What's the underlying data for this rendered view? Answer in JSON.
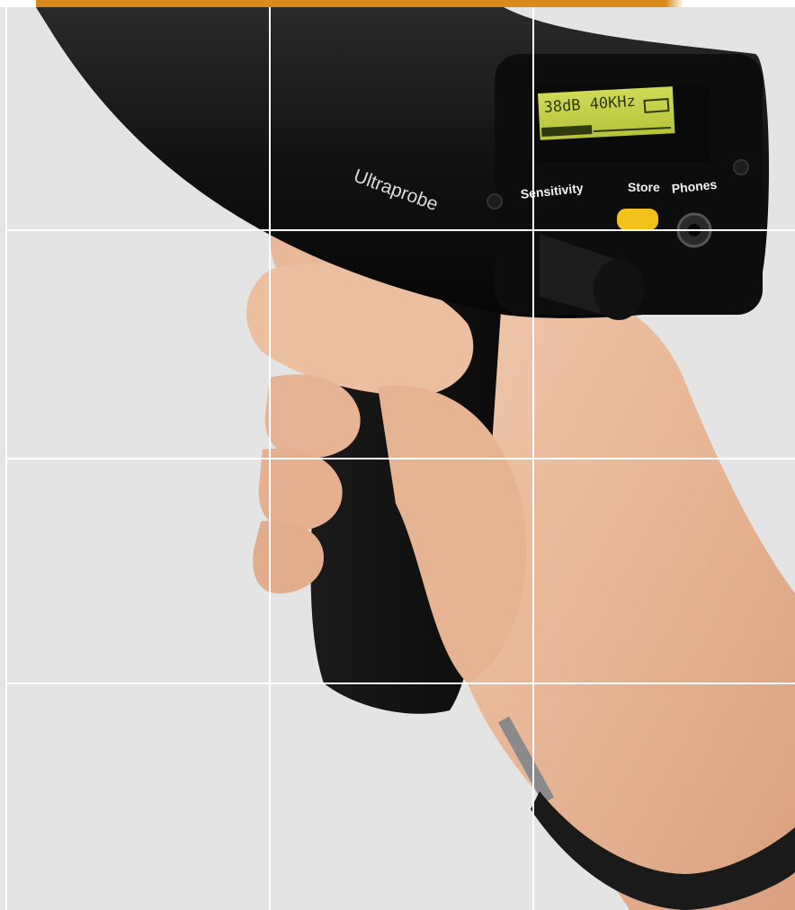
{
  "device": {
    "brand_label": "Ultraprobe",
    "sensitivity_label": "Sensitivity",
    "store_label": "Store",
    "phones_label": "Phones",
    "display": {
      "line1": "38dB  40KHz"
    }
  },
  "colors": {
    "background": "#e4e4e4",
    "top_band": "#d98a1a",
    "grid_lines": "#ffffff",
    "device_body": "#141414",
    "lcd": "#c6d24a",
    "store_button": "#f2c21a",
    "skin": "#e7b89a"
  },
  "icons": [
    "battery-icon"
  ]
}
